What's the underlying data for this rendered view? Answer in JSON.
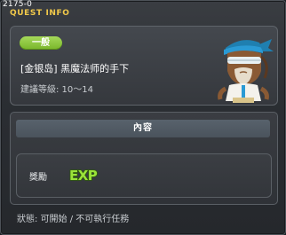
{
  "window": {
    "quest_id": "2175-0",
    "title": "QUEST INFO"
  },
  "quest": {
    "level_badge": "一般",
    "name": "[金银岛] 黑魔法师的手下",
    "recommended_level": "建議等級: 10～14"
  },
  "details": {
    "section_title": "內容",
    "reward_label": "獎勵",
    "reward_icon": "exp-icon",
    "reward_text": "EXP"
  },
  "status_text": "狀態: 可開始 / 不可執行任務",
  "colors": {
    "title": "#f2c94a",
    "badge": "#8cc63f",
    "exp_fill": "#9be23a"
  }
}
